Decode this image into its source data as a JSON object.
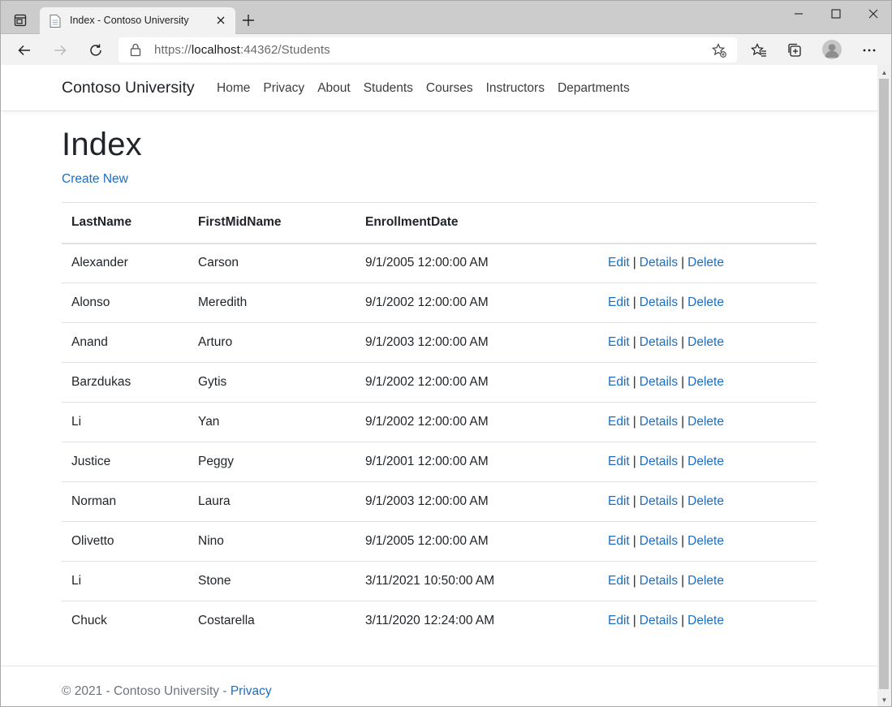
{
  "browser": {
    "tab_title": "Index - Contoso University",
    "url_prefix": "https://",
    "url_host": "localhost",
    "url_rest": ":44362/Students"
  },
  "site": {
    "brand": "Contoso University",
    "nav": [
      "Home",
      "Privacy",
      "About",
      "Students",
      "Courses",
      "Instructors",
      "Departments"
    ]
  },
  "main": {
    "title": "Index",
    "create_link": "Create New",
    "table": {
      "headers": [
        "LastName",
        "FirstMidName",
        "EnrollmentDate"
      ],
      "rows": [
        [
          "Alexander",
          "Carson",
          "9/1/2005 12:00:00 AM"
        ],
        [
          "Alonso",
          "Meredith",
          "9/1/2002 12:00:00 AM"
        ],
        [
          "Anand",
          "Arturo",
          "9/1/2003 12:00:00 AM"
        ],
        [
          "Barzdukas",
          "Gytis",
          "9/1/2002 12:00:00 AM"
        ],
        [
          "Li",
          "Yan",
          "9/1/2002 12:00:00 AM"
        ],
        [
          "Justice",
          "Peggy",
          "9/1/2001 12:00:00 AM"
        ],
        [
          "Norman",
          "Laura",
          "9/1/2003 12:00:00 AM"
        ],
        [
          "Olivetto",
          "Nino",
          "9/1/2005 12:00:00 AM"
        ],
        [
          "Li",
          "Stone",
          "3/11/2021 10:50:00 AM"
        ],
        [
          "Chuck",
          "Costarella",
          "3/11/2020 12:24:00 AM"
        ]
      ],
      "actions": {
        "edit": "Edit",
        "details": "Details",
        "delete": "Delete",
        "separator": "|"
      }
    }
  },
  "footer": {
    "text": "© 2021 - Contoso University - ",
    "privacy_link": "Privacy"
  },
  "colors": {
    "link": "#1b6ec2",
    "text": "#212529",
    "muted": "#6c757d"
  }
}
